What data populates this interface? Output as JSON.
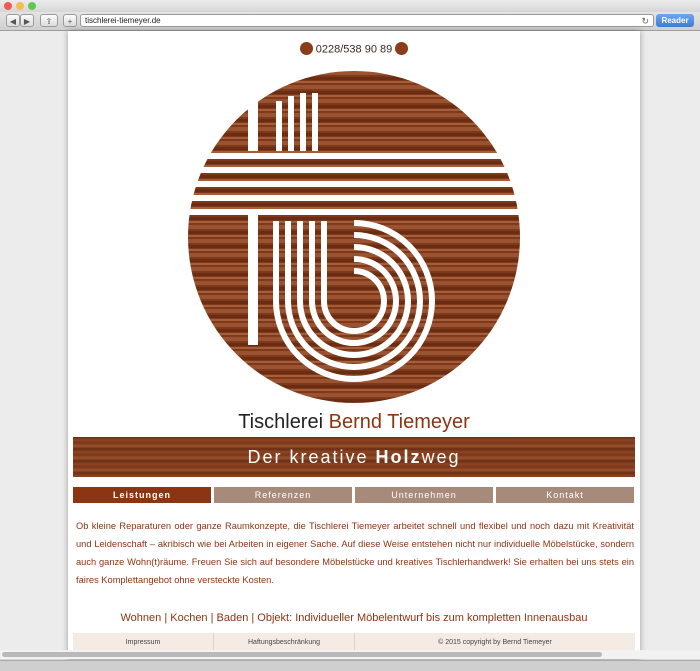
{
  "browser": {
    "url": "tischlerei-tiemeyer.de",
    "reader_label": "Reader",
    "traffic_lights": [
      "#ee5b54",
      "#f4be4f",
      "#62c655"
    ]
  },
  "header": {
    "phone": "0228/538 90 89"
  },
  "brand": {
    "title_prefix": "Tischlerei",
    "title_name": "Bernd Tiemeyer",
    "slogan_prefix": "Der kreative",
    "slogan_bold": "Holz",
    "slogan_suffix": "weg"
  },
  "nav": {
    "items": [
      {
        "label": "Leistungen",
        "active": true
      },
      {
        "label": "Referenzen",
        "active": false
      },
      {
        "label": "Unternehmen",
        "active": false
      },
      {
        "label": "Kontakt",
        "active": false
      }
    ]
  },
  "content": {
    "intro": "Ob kleine Reparaturen oder ganze Raumkonzepte, die Tischlerei Tiemeyer arbeitet schnell und flexibel und noch dazu mit Kreativität und Leidenschaft – akribisch wie bei Arbeiten in eigener Sache. Auf diese Weise entstehen nicht nur individuelle Möbelstücke, sondern auch ganze Wohn(t)räume. Freuen Sie sich auf besondere Möbelstücke und kreatives Tischlerhandwerk! Sie erhalten bei uns stets ein faires Komplettangebot ohne versteckte Kosten.",
    "services": "Wohnen | Kochen | Baden | Objekt: Individueller Möbelentwurf bis zum kompletten Innenausbau"
  },
  "footer": {
    "impressum": "Impressum",
    "haftung": "Haftungsbeschränkung",
    "copyright": "© 2015 copyright by Bernd Tiemeyer"
  },
  "colors": {
    "brand": "#8b3513",
    "nav_inactive": "#a88a7b",
    "footer_bg": "#f4ebe4"
  },
  "icons": [
    "back-icon",
    "forward-icon",
    "share-icon",
    "add-tab-icon",
    "reload-icon",
    "phone-icon",
    "logo-mini-icon"
  ]
}
